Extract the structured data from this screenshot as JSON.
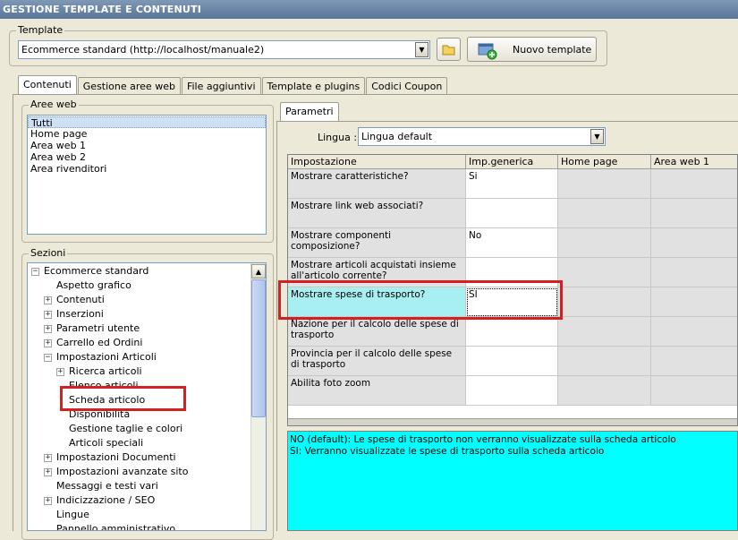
{
  "window": {
    "title": "GESTIONE TEMPLATE E CONTENUTI"
  },
  "template": {
    "group_label": "Template",
    "selected": "Ecommerce standard (http://localhost/manuale2)",
    "new_template_label": "Nuovo template"
  },
  "tabs": [
    {
      "label": "Contenuti",
      "active": true
    },
    {
      "label": "Gestione aree web"
    },
    {
      "label": "File aggiuntivi"
    },
    {
      "label": "Template e plugins"
    },
    {
      "label": "Codici Coupon"
    }
  ],
  "aree_web": {
    "label": "Aree web",
    "items": [
      "Tutti",
      "Home page",
      "Area web 1",
      "Area web 2",
      "Area rivenditori"
    ]
  },
  "sezioni": {
    "label": "Sezioni",
    "tree": [
      {
        "label": "Ecommerce standard",
        "level": 0,
        "expander": "−"
      },
      {
        "label": "Aspetto grafico",
        "level": 1,
        "expander": ""
      },
      {
        "label": "Contenuti",
        "level": 1,
        "expander": "+"
      },
      {
        "label": "Inserzioni",
        "level": 1,
        "expander": "+"
      },
      {
        "label": "Parametri utente",
        "level": 1,
        "expander": "+"
      },
      {
        "label": "Carrello ed Ordini",
        "level": 1,
        "expander": "+"
      },
      {
        "label": "Impostazioni Articoli",
        "level": 1,
        "expander": "−"
      },
      {
        "label": "Ricerca articoli",
        "level": 2,
        "expander": "+"
      },
      {
        "label": "Elenco articoli",
        "level": 2,
        "expander": ""
      },
      {
        "label": "Scheda articolo",
        "level": 2,
        "expander": ""
      },
      {
        "label": "Disponibilità",
        "level": 2,
        "expander": ""
      },
      {
        "label": "Gestione taglie e colori",
        "level": 2,
        "expander": ""
      },
      {
        "label": "Articoli speciali",
        "level": 2,
        "expander": ""
      },
      {
        "label": "Impostazioni Documenti",
        "level": 1,
        "expander": "+"
      },
      {
        "label": "Impostazioni avanzate sito",
        "level": 1,
        "expander": "+"
      },
      {
        "label": "Messaggi e testi vari",
        "level": 1,
        "expander": ""
      },
      {
        "label": "Indicizzazione / SEO",
        "level": 1,
        "expander": "+"
      },
      {
        "label": "Lingue",
        "level": 1,
        "expander": ""
      },
      {
        "label": "Pannello amministrativo",
        "level": 1,
        "expander": ""
      }
    ]
  },
  "parametri": {
    "tab_label": "Parametri",
    "lingua_label": "Lingua :",
    "lingua_value": "Lingua default",
    "columns": [
      "Impostazione",
      "Imp.generica",
      "Home page",
      "Area web 1"
    ],
    "rows": [
      {
        "setting": "Mostrare caratteristiche?",
        "value": "Si"
      },
      {
        "setting": "Mostrare link web associati?",
        "value": ""
      },
      {
        "setting": "Mostrare componenti composizione?",
        "value": "No"
      },
      {
        "setting": "Mostrare articoli acquistati insieme all'articolo corrente?",
        "value": ""
      },
      {
        "setting": "Mostrare spese di trasporto?",
        "value": "SI"
      },
      {
        "setting": "Nazione per il calcolo delle spese di trasporto",
        "value": ""
      },
      {
        "setting": "Provincia per il calcolo delle spese di trasporto",
        "value": ""
      },
      {
        "setting": "Abilita foto zoom",
        "value": ""
      }
    ],
    "info_lines": [
      "NO (default): Le spese di trasporto non verranno visualizzate sulla scheda articolo",
      "SI: Verranno visualizzate le spese di trasporto sulla scheda articolo"
    ]
  },
  "colors": {
    "highlight": "#d32020",
    "info_bg": "#00ffff",
    "selected_cell": "#a8eff2"
  }
}
